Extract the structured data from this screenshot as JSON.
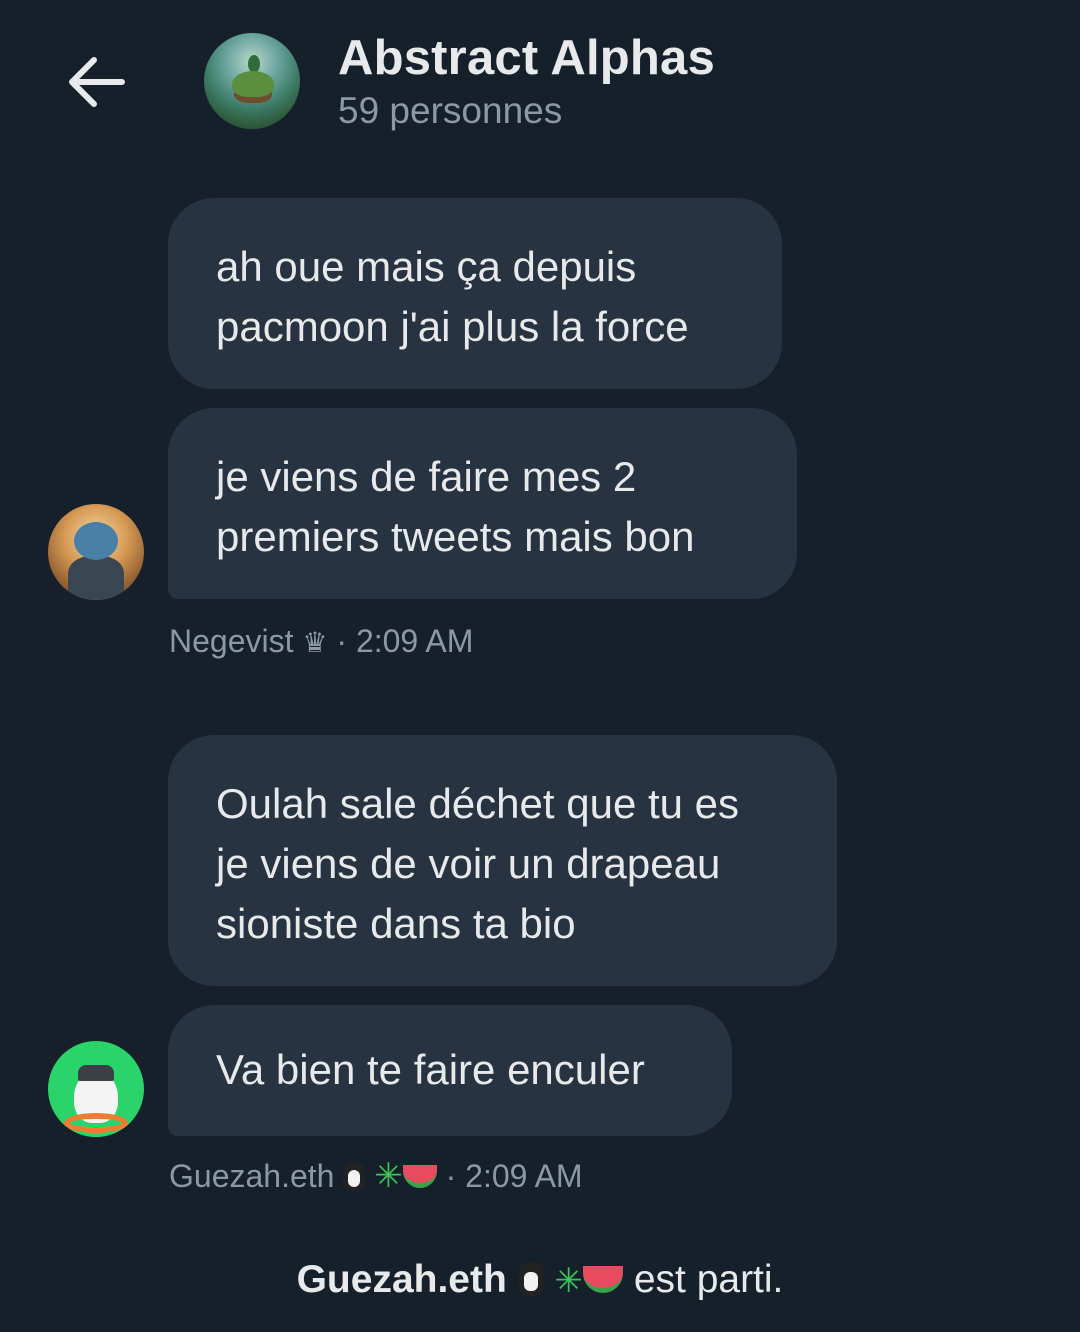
{
  "header": {
    "title": "Abstract Alphas",
    "subtitle": "59 personnes"
  },
  "messages": [
    {
      "text": "ah oue mais ça depuis\npacmoon j'ai plus la force"
    },
    {
      "text": "je viens de faire mes 2\npremiers tweets mais bon"
    },
    {
      "text": "Oulah sale déchet que tu es\nje viens de voir un drapeau\nsioniste dans ta bio"
    },
    {
      "text": "Va bien te faire enculer"
    }
  ],
  "meta": [
    {
      "sender": "Negevist",
      "separator": "·",
      "time": "2:09 AM",
      "icon": "crown-icon"
    },
    {
      "sender": "Guezah.eth",
      "separator": "·",
      "time": "2:09 AM",
      "icons": [
        "penguin-icon",
        "sparkle-icon",
        "watermelon-icon"
      ]
    }
  ],
  "system": {
    "name": "Guezah.eth",
    "text": "est parti.",
    "icons": [
      "penguin-icon",
      "sparkle-icon",
      "watermelon-icon"
    ]
  },
  "colors": {
    "background": "#15202b",
    "bubble": "#273340",
    "muted": "#8b98a5",
    "text": "#e7e9ea"
  }
}
